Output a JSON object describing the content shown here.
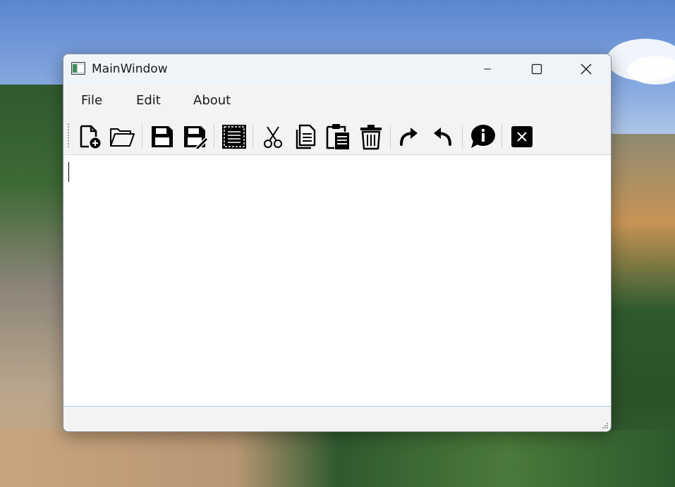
{
  "window": {
    "title": "MainWindow"
  },
  "menu": {
    "items": [
      "File",
      "Edit",
      "About"
    ]
  },
  "toolbar": {
    "buttons": [
      {
        "icon": "new-file-icon"
      },
      {
        "icon": "open-folder-icon"
      },
      {
        "icon": "save-icon"
      },
      {
        "icon": "save-as-icon"
      },
      {
        "icon": "select-all-icon"
      },
      {
        "icon": "cut-icon"
      },
      {
        "icon": "copy-icon"
      },
      {
        "icon": "paste-icon"
      },
      {
        "icon": "delete-icon"
      },
      {
        "icon": "redo-icon"
      },
      {
        "icon": "undo-icon"
      },
      {
        "icon": "info-icon"
      },
      {
        "icon": "close-icon"
      }
    ]
  },
  "editor": {
    "text": ""
  },
  "colors": {
    "titlebar": "#eff4f9",
    "chrome": "#f3f3f3",
    "editor_bg": "#ffffff",
    "focus_border": "#9cc4e4"
  }
}
